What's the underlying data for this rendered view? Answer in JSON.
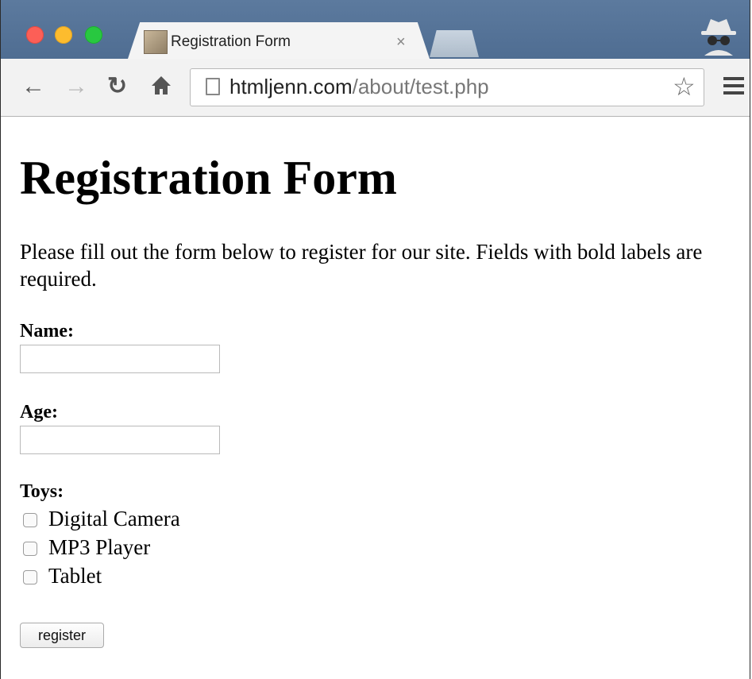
{
  "browser": {
    "tab_title": "Registration Form",
    "tab_close": "×",
    "url_host": "htmljenn.com",
    "url_path": "/about/test.php",
    "icons": {
      "back": "back-arrow-icon",
      "forward": "forward-arrow-icon",
      "reload": "reload-icon",
      "home": "home-icon",
      "bookmark": "star-icon",
      "menu": "hamburger-menu-icon",
      "incognito": "incognito-icon",
      "page": "page-icon"
    }
  },
  "page": {
    "heading": "Registration Form",
    "intro": "Please fill out the form below to register for our site. Fields with bold labels are required.",
    "name_label": "Name:",
    "name_value": "",
    "age_label": "Age:",
    "age_value": "",
    "toys_label": "Toys:",
    "toys": [
      {
        "label": "Digital Camera",
        "checked": false
      },
      {
        "label": "MP3 Player",
        "checked": false
      },
      {
        "label": "Tablet",
        "checked": false
      }
    ],
    "submit_label": "register"
  }
}
